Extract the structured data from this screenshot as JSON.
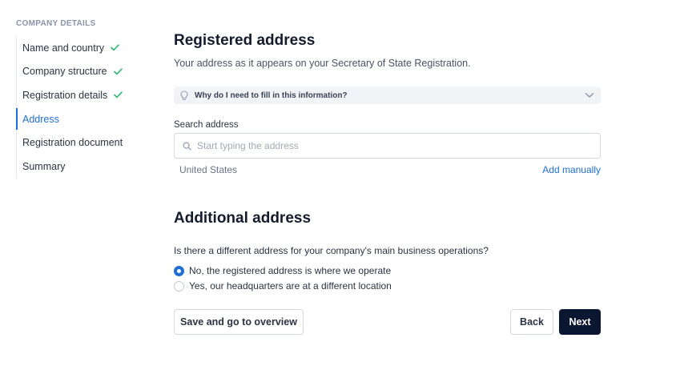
{
  "sidebar": {
    "heading": "COMPANY DETAILS",
    "steps": [
      {
        "label": "Name and country",
        "completed": true
      },
      {
        "label": "Company structure",
        "completed": true
      },
      {
        "label": "Registration details",
        "completed": true
      },
      {
        "label": "Address",
        "completed": false,
        "active": true
      },
      {
        "label": "Registration document",
        "completed": false
      },
      {
        "label": "Summary",
        "completed": false
      }
    ]
  },
  "registered": {
    "title": "Registered address",
    "subtitle": "Your address as it appears on your Secretary of State Registration.",
    "info_text": "Why do I need to fill in this information?",
    "search_label": "Search address",
    "search_placeholder": "Start typing the address",
    "search_value": "",
    "country": "United States",
    "add_manually": "Add manually"
  },
  "additional": {
    "title": "Additional address",
    "question": "Is there a different address for your company's main business operations?",
    "options": [
      {
        "label": "No, the registered address is where we operate",
        "selected": true
      },
      {
        "label": "Yes, our headquarters are at a different location",
        "selected": false
      }
    ]
  },
  "actions": {
    "save_label": "Save and go to overview",
    "back_label": "Back",
    "next_label": "Next"
  },
  "colors": {
    "accent": "#1f6fd6",
    "check": "#2bb673",
    "primary_button": "#0b1630"
  },
  "icons": {
    "step_complete": "check-icon",
    "info": "lightbulb-icon",
    "expand": "chevron-down-icon",
    "search": "search-icon"
  }
}
